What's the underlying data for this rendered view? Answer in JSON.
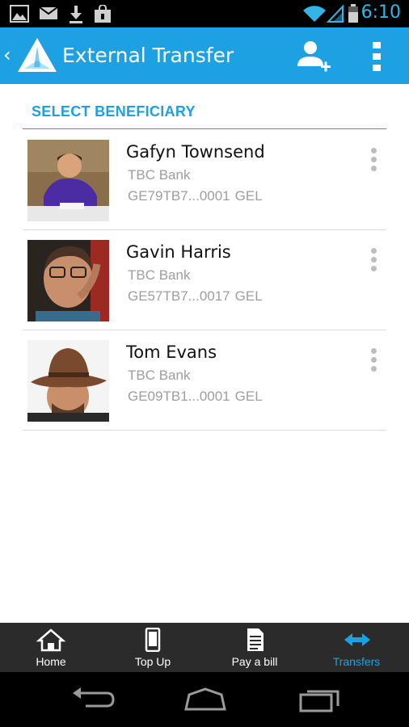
{
  "status_bar": {
    "time": "6:10",
    "icons": [
      "gallery-icon",
      "mail-icon",
      "download-icon",
      "store-icon",
      "wifi-icon",
      "signal-icon",
      "battery-icon"
    ]
  },
  "action_bar": {
    "back_glyph": "‹",
    "title": "External Transfer",
    "color": "#1da1e2"
  },
  "section": {
    "title": "SELECT BENEFICIARY"
  },
  "beneficiaries": [
    {
      "name": "Gafyn Townsend",
      "bank": "TBC Bank",
      "account": "GE79TB7...0001",
      "currency": "GEL"
    },
    {
      "name": "Gavin Harris",
      "bank": "TBC Bank",
      "account": "GE57TB7...0017",
      "currency": "GEL"
    },
    {
      "name": "Tom Evans",
      "bank": "TBC Bank",
      "account": "GE09TB1...0001",
      "currency": "GEL"
    }
  ],
  "tabs": [
    {
      "label": "Home",
      "icon": "home-icon",
      "active": false
    },
    {
      "label": "Top Up",
      "icon": "phone-icon",
      "active": false
    },
    {
      "label": "Pay a bill",
      "icon": "bill-icon",
      "active": false
    },
    {
      "label": "Transfers",
      "icon": "transfer-arrows-icon",
      "active": true
    }
  ],
  "colors": {
    "accent": "#1da1e2",
    "secondary_text": "#9e9e9e",
    "tab_bar": "#2b2b2b"
  }
}
